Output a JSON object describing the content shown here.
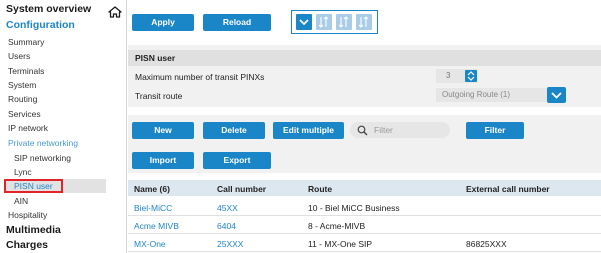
{
  "sidebar": {
    "system_overview": "System overview",
    "configuration": "Configuration",
    "items": [
      {
        "label": "Summary"
      },
      {
        "label": "Users"
      },
      {
        "label": "Terminals"
      },
      {
        "label": "System"
      },
      {
        "label": "Routing"
      },
      {
        "label": "Services"
      },
      {
        "label": "IP network"
      },
      {
        "label": "Private networking"
      },
      {
        "label": "SIP networking"
      },
      {
        "label": "Lync"
      },
      {
        "label": "PISN user"
      },
      {
        "label": "AIN"
      },
      {
        "label": "Hospitality"
      }
    ],
    "multimedia": "Multimedia",
    "charges": "Charges",
    "selected": "PISN user"
  },
  "toolbar": {
    "apply_label": "Apply",
    "reload_label": "Reload"
  },
  "pisn": {
    "header": "PISN user",
    "max_transit_label": "Maximum number of transit PINXs",
    "max_transit_value": "3",
    "transit_route_label": "Transit route",
    "transit_route_value": "Outgoing Route (1)"
  },
  "list_toolbar": {
    "new_label": "New",
    "delete_label": "Delete",
    "edit_multiple_label": "Edit multiple",
    "filter_placeholder": "Filter",
    "filter_button_label": "Filter",
    "import_label": "Import",
    "export_label": "Export"
  },
  "table": {
    "columns": [
      "Name (6)",
      "Call number",
      "Route",
      "External call number"
    ],
    "rows": [
      {
        "name": "Biel-MiCC",
        "call_number": "45XX",
        "route": "10 - Biel MiCC Business",
        "external": ""
      },
      {
        "name": "Acme MIVB",
        "call_number": "6404",
        "route": "8 - Acme-MIVB",
        "external": ""
      },
      {
        "name": "MX-One",
        "call_number": "25XXX",
        "route": "11 - MX-One SIP",
        "external": "86825XXX"
      }
    ]
  },
  "colors": {
    "accent": "#1a86c7",
    "link": "#1f86c8",
    "selection_outline": "#e0242a"
  }
}
